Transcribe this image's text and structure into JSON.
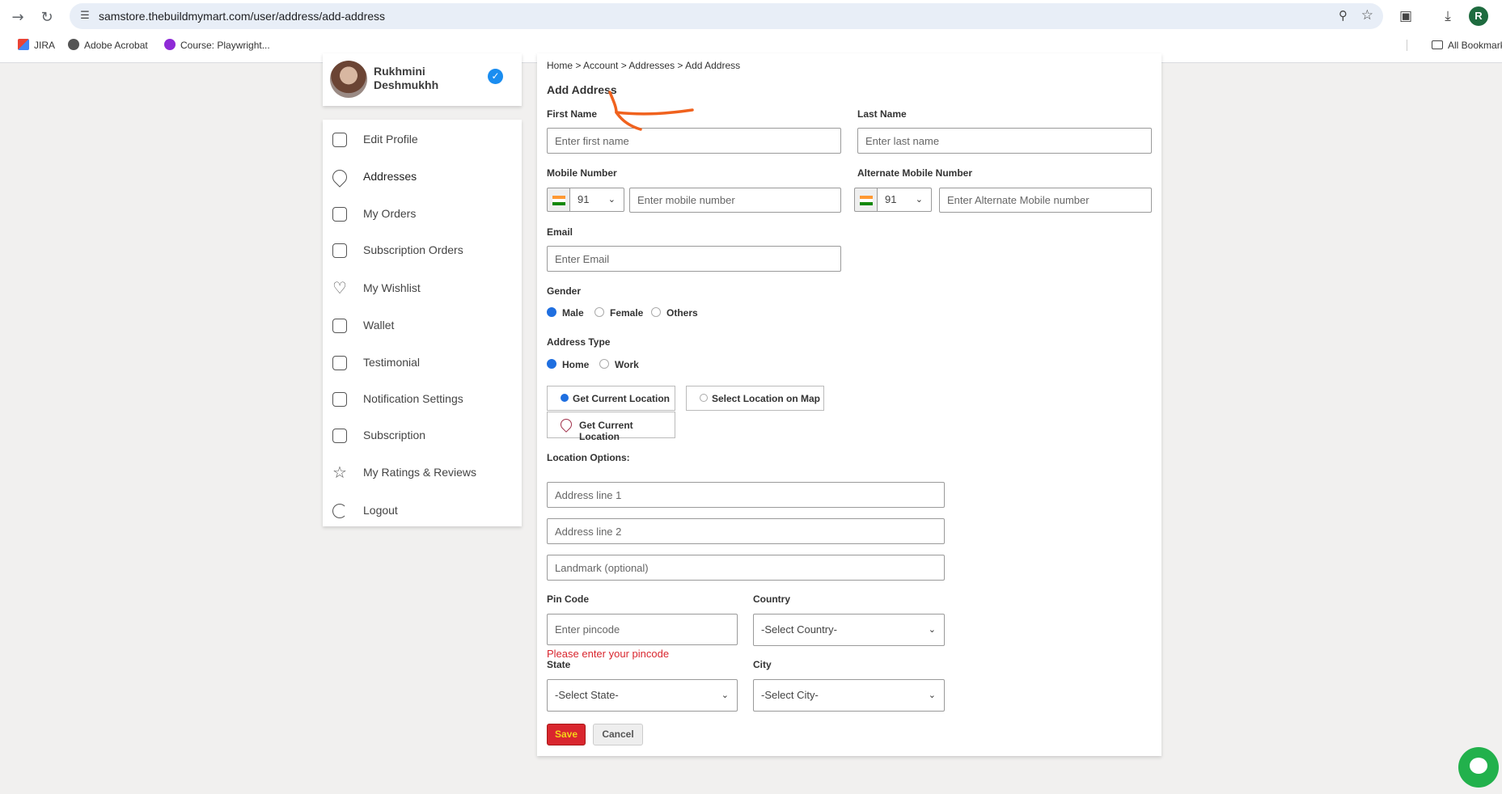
{
  "browser": {
    "url": "samstore.thebuildmymart.com/user/address/add-address",
    "profile_initial": "R",
    "bookmarks": [
      {
        "label": "JIRA",
        "icon": "gmail-icon"
      },
      {
        "label": "Adobe Acrobat",
        "icon": "globe-icon"
      },
      {
        "label": "Course: Playwright...",
        "icon": "course-icon"
      }
    ],
    "all_bookmarks": "All Bookmarks"
  },
  "profile": {
    "name": "Rukhmini Deshmukhh"
  },
  "sidebar": {
    "items": [
      {
        "label": "Edit Profile",
        "icon": "user-icon"
      },
      {
        "label": "Addresses",
        "icon": "location-pin-icon"
      },
      {
        "label": "My Orders",
        "icon": "orders-icon"
      },
      {
        "label": "Subscription Orders",
        "icon": "subscription-orders-icon"
      },
      {
        "label": "My Wishlist",
        "icon": "heart-icon"
      },
      {
        "label": "Wallet",
        "icon": "wallet-icon"
      },
      {
        "label": "Testimonial",
        "icon": "quote-icon"
      },
      {
        "label": "Notification Settings",
        "icon": "notification-icon"
      },
      {
        "label": "Subscription",
        "icon": "subscription-icon"
      },
      {
        "label": "My Ratings & Reviews",
        "icon": "star-icon"
      },
      {
        "label": "Logout",
        "icon": "logout-icon"
      }
    ]
  },
  "main": {
    "breadcrumb": "Home > Account > Addresses > Add Address",
    "title": "Add Address",
    "first_name": {
      "label": "First Name",
      "placeholder": "Enter first name"
    },
    "last_name": {
      "label": "Last Name",
      "placeholder": "Enter last name"
    },
    "mobile": {
      "label": "Mobile Number",
      "code": "91",
      "placeholder": "Enter mobile number"
    },
    "alt_mobile": {
      "label": "Alternate Mobile Number",
      "code": "91",
      "placeholder": "Enter Alternate Mobile number"
    },
    "email": {
      "label": "Email",
      "placeholder": "Enter Email"
    },
    "gender": {
      "label": "Gender",
      "options": [
        "Male",
        "Female",
        "Others"
      ],
      "selected": "Male"
    },
    "address_type": {
      "label": "Address Type",
      "options": [
        "Home",
        "Work"
      ],
      "selected": "Home"
    },
    "location": {
      "tab_current": "Get Current Location",
      "tab_map": "Select Location on Map",
      "button": "Get Current Location",
      "options_label": "Location Options:"
    },
    "address_line1": {
      "placeholder": "Address line 1"
    },
    "address_line2": {
      "placeholder": "Address line 2"
    },
    "landmark": {
      "placeholder": "Landmark (optional)"
    },
    "pincode": {
      "label": "Pin Code",
      "placeholder": "Enter pincode",
      "error": "Please enter your pincode"
    },
    "country": {
      "label": "Country",
      "value": "-Select Country-"
    },
    "state": {
      "label": "State",
      "value": "-Select State-"
    },
    "city": {
      "label": "City",
      "value": "-Select City-"
    },
    "save": "Save",
    "cancel": "Cancel"
  },
  "colors": {
    "accent_red": "#d9262e",
    "radio_blue": "#1f6fe0",
    "annotation_orange": "#f0621e",
    "chat_green": "#22b14c"
  }
}
